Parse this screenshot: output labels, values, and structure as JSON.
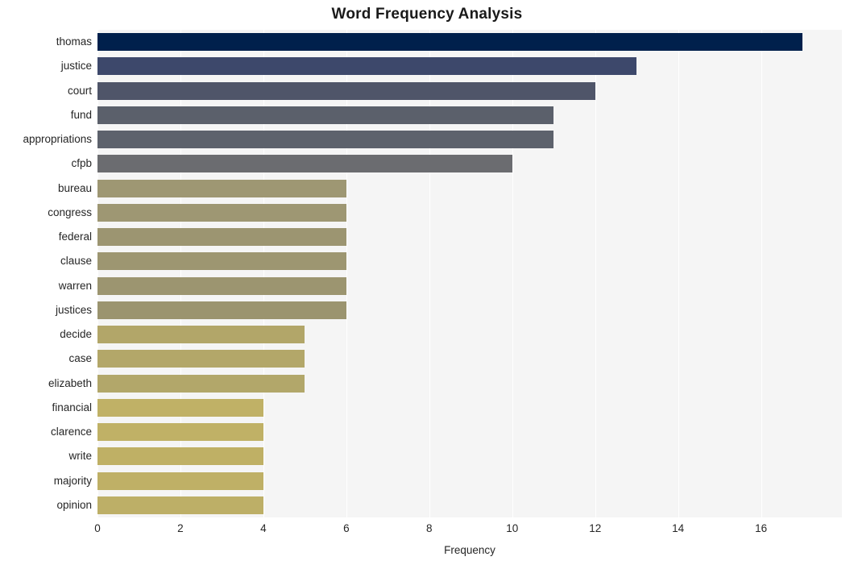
{
  "chart_data": {
    "type": "bar",
    "orientation": "horizontal",
    "title": "Word Frequency Analysis",
    "xlabel": "Frequency",
    "ylabel": "",
    "categories": [
      "thomas",
      "justice",
      "court",
      "fund",
      "appropriations",
      "cfpb",
      "bureau",
      "congress",
      "federal",
      "clause",
      "warren",
      "justices",
      "decide",
      "case",
      "elizabeth",
      "financial",
      "clarence",
      "write",
      "majority",
      "opinion"
    ],
    "values": [
      17,
      13,
      12,
      11,
      11,
      10,
      6,
      6,
      6,
      6,
      6,
      6,
      5,
      5,
      5,
      4,
      4,
      4,
      4,
      4
    ],
    "bar_colors": [
      "#00204c",
      "#3d486b",
      "#4f5569",
      "#5b606b",
      "#5d626c",
      "#6b6c70",
      "#9e9773",
      "#9e9773",
      "#9c9571",
      "#9d9671",
      "#9c9570",
      "#9b946f",
      "#b2a669",
      "#b3a769",
      "#b2a76a",
      "#c0b166",
      "#c0b166",
      "#bfb065",
      "#bfb066",
      "#bdaf67"
    ],
    "xlim": [
      0,
      17.95
    ],
    "xticks": [
      0,
      2,
      4,
      6,
      8,
      10,
      12,
      14,
      16
    ],
    "xtick_labels": [
      "0",
      "2",
      "4",
      "6",
      "8",
      "10",
      "12",
      "14",
      "16"
    ],
    "grid": true,
    "grid_axis": "x",
    "grid_color": "#ffffff",
    "plot_background": "#f5f5f5",
    "figure_background": "#ffffff",
    "legend": null
  }
}
